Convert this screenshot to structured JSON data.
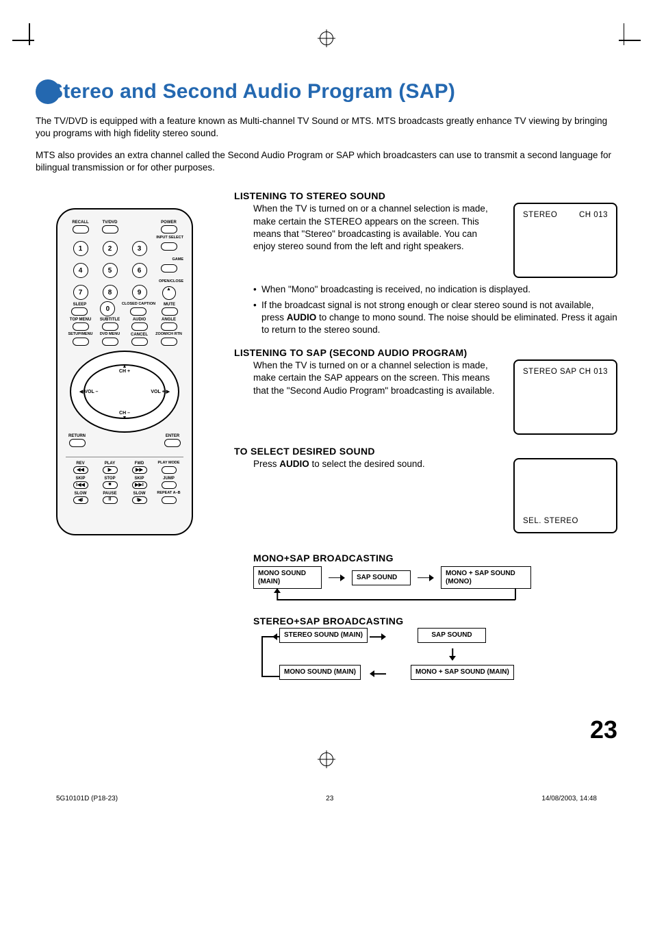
{
  "title": "Stereo and Second Audio Program (SAP)",
  "intro_p1": "The TV/DVD is equipped with a feature known as Multi-channel TV Sound or MTS. MTS broadcasts greatly enhance TV viewing by bringing you programs with high fidelity stereo sound.",
  "intro_p2": "MTS also provides an extra channel called the Second Audio Program or SAP which broadcasters can use to transmit a second language for bilingual transmission or for other purposes.",
  "sect1_head": "LISTENING TO STEREO SOUND",
  "sect1_body": "When the TV is turned on or a channel selection is made, make certain the STEREO appears on the screen. This means that \"Stereo\" broadcasting is available. You can enjoy stereo sound from the left and right speakers.",
  "sect1_bullet1": "When \"Mono\" broadcasting is received, no indication is displayed.",
  "sect1_bullet2_a": "If the broadcast signal is not strong enough or clear stereo sound is not available, press ",
  "sect1_bullet2_key": "AUDIO",
  "sect1_bullet2_b": " to change to mono sound. The noise should be eliminated. Press it again to return to the stereo sound.",
  "screen1_left": "STEREO",
  "screen1_right": "CH 013",
  "sect2_head": "LISTENING TO SAP (SECOND AUDIO PROGRAM)",
  "sect2_body": "When the TV is turned on or a channel selection is made, make certain the SAP appears on the screen. This means that the \"Second Audio Program\" broadcasting is available.",
  "screen2_left": "STEREO  SAP",
  "screen2_right": "CH 013",
  "sect3_head": "TO SELECT DESIRED SOUND",
  "sect3_body_a": "Press ",
  "sect3_body_key": "AUDIO",
  "sect3_body_b": " to select the desired sound.",
  "screen3_text": "SEL. STEREO",
  "flow1_head": "MONO+SAP BROADCASTING",
  "flow1_box1": "MONO SOUND (MAIN)",
  "flow1_box2": "SAP SOUND",
  "flow1_box3": "MONO + SAP SOUND (MONO)",
  "flow2_head": "STEREO+SAP BROADCASTING",
  "flow2_box1": "STEREO SOUND (MAIN)",
  "flow2_box2": "SAP SOUND",
  "flow2_box3": "MONO SOUND (MAIN)",
  "flow2_box4": "MONO + SAP SOUND (MAIN)",
  "pagenum": "23",
  "footer_left": "5G10101D (P18-23)",
  "footer_mid": "23",
  "footer_right": "14/08/2003, 14:48",
  "remote": {
    "r1": [
      "RECALL",
      "TV/DVD",
      "",
      "POWER"
    ],
    "input_sel": "INPUT SELECT",
    "nums1": [
      "1",
      "2",
      "3"
    ],
    "game": "GAME",
    "nums2": [
      "4",
      "5",
      "6"
    ],
    "openclose": "OPEN/CLOSE",
    "nums3": [
      "7",
      "8",
      "9"
    ],
    "sleep_row": [
      "SLEEP",
      "0",
      "CLOSED CAPTION",
      "MUTE"
    ],
    "menu1": [
      "TOP MENU",
      "SUBTITLE",
      "AUDIO",
      "ANGLE"
    ],
    "menu2": [
      "SETUP/MENU",
      "DVD MENU",
      "CANCEL",
      "ZOOM/CH RTN"
    ],
    "ring": {
      "up": "CH +",
      "down": "CH –",
      "left": " VOL –",
      "right": "VOL + "
    },
    "under": [
      "RETURN",
      "ENTER"
    ],
    "play1": [
      "REV",
      "PLAY",
      "FWD",
      "PLAY MODE"
    ],
    "play2": [
      "SKIP",
      "STOP",
      "SKIP",
      "JUMP"
    ],
    "play3": [
      "SLOW",
      "PAUSE",
      "SLOW",
      "REPEAT A–B"
    ]
  }
}
